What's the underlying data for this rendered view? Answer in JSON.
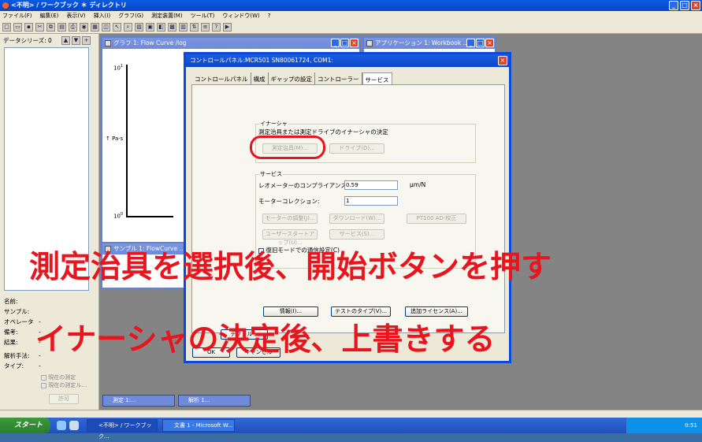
{
  "app": {
    "title": "<不明> / ワークブック ＊ ディレクトリ",
    "menus": [
      "ファイル(F)",
      "編集(E)",
      "表示(V)",
      "挿入(I)",
      "グラフ(G)",
      "測定装置(M)",
      "ツール(T)",
      "ウィンドウ(W)",
      "?"
    ]
  },
  "left_panel": {
    "series_label": "データシリーズ: 0",
    "fields": [
      {
        "label": "名前:",
        "value": ""
      },
      {
        "label": "サンプル:",
        "value": ""
      },
      {
        "label": "オペレータ",
        "value": "-"
      },
      {
        "label": "備考:",
        "value": "-"
      },
      {
        "label": "結果:",
        "value": "-"
      }
    ],
    "analysis_label": "解析手法:",
    "analysis_value": "-",
    "type_label": "タイプ:",
    "type_value": "-",
    "checkbox_current": "現在の測定",
    "checkbox_current_2": "現在の測定ル…",
    "allow_button": "許可"
  },
  "graph_window": {
    "title": "グラフ 1: Flow Curve /log",
    "y_top_tick": "10",
    "y_top_exp": "1",
    "y_bottom_tick": "10",
    "y_bottom_exp": "0",
    "y_axis_label": "Pa·s"
  },
  "app_window": {
    "title": "アプリケーション 1: Workbook ..."
  },
  "sample_window": {
    "title": "サンプル 1: FlowCurve ..."
  },
  "dialog": {
    "title": "コントロールパネル:MCR501 SN80061724, COM1:",
    "tabs": [
      "コントロールパネル",
      "構成",
      "ギャップの設定",
      "コントローラー",
      "サービス"
    ],
    "inertia_group": "イナーシャ",
    "inertia_desc": "測定治具または測定ドライブのイナーシャの決定",
    "btn_geometry": "測定治具(M)...",
    "btn_drive": "ドライブ(D)...",
    "service_group": "サービス",
    "compliance_label": "レオメーターのコンプライアンス(E):",
    "compliance_value": "0.59",
    "compliance_unit": "µm/N",
    "motor_label": "モーターコレクション:",
    "motor_value": "1",
    "btn_motor_adjust": "モーターの調整(J)...",
    "btn_download": "ダウンロード(W)...",
    "btn_pt100": "PT100 AD-校正",
    "btn_user_start": "ユーザースタートアップ(U)...",
    "btn_service": "サービス(S)...",
    "restore_checkbox": "復旧モードでの通信設定(C)",
    "btn_info": "情報(I)...",
    "btn_test_type": "テストのタイプ(V)...",
    "btn_add_license": "追加ライセンス(A)...",
    "btn_ok": "OK",
    "btn_cancel": "キャンセル",
    "btn_default": "デフォルト"
  },
  "annotations": {
    "line1": "測定治具を選択後、開始ボタンを押す",
    "line2": "イナーシャの決定後、上書きする"
  },
  "minimized": [
    {
      "label": "測定 1:..."
    },
    {
      "label": "解析 1..."
    }
  ],
  "taskbar": {
    "start": "スタート",
    "tasks": [
      "<不明> / ワークブック...",
      "文書 1 - Microsoft W..."
    ],
    "clock": "0:51"
  }
}
